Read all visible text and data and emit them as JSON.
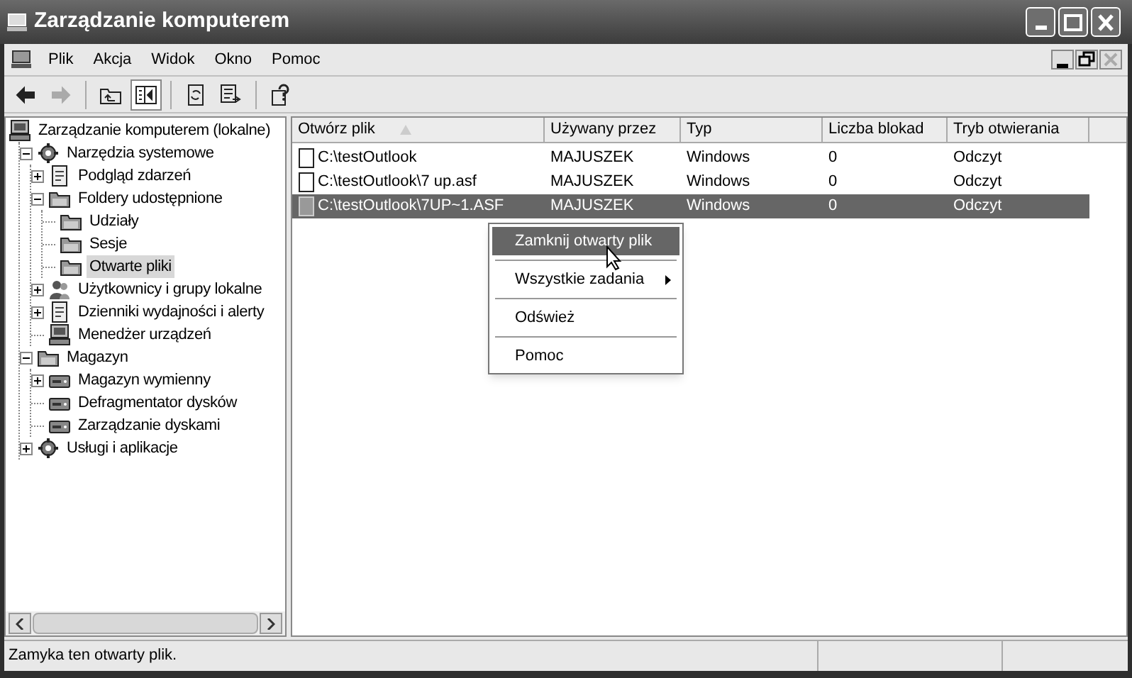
{
  "window": {
    "title": "Zarządzanie komputerem"
  },
  "menu_bar": [
    "Plik",
    "Akcja",
    "Widok",
    "Okno",
    "Pomoc"
  ],
  "mdi_controls": [
    {
      "kind": "minimize",
      "disabled": false
    },
    {
      "kind": "restore",
      "disabled": false
    },
    {
      "kind": "close",
      "disabled": true
    }
  ],
  "toolbar": [
    {
      "kind": "back",
      "disabled": false,
      "pressed": false
    },
    {
      "kind": "forward",
      "disabled": true,
      "pressed": false
    },
    {
      "kind": "separator"
    },
    {
      "kind": "up",
      "disabled": false,
      "pressed": false
    },
    {
      "kind": "tree",
      "disabled": false,
      "pressed": true
    },
    {
      "kind": "separator"
    },
    {
      "kind": "refresh",
      "disabled": false,
      "pressed": false
    },
    {
      "kind": "export",
      "disabled": false,
      "pressed": false
    },
    {
      "kind": "separator"
    },
    {
      "kind": "help",
      "disabled": false,
      "pressed": false
    }
  ],
  "tree": [
    {
      "label": "Zarządzanie komputerem (lokalne)",
      "kind": "computer",
      "selected": false,
      "children": [
        {
          "label": "Narzędzia systemowe",
          "kind": "gear",
          "expanded": true,
          "selected": false,
          "children": [
            {
              "label": "Podgląd zdarzeń",
              "kind": "document",
              "expanded": false,
              "selected": false
            },
            {
              "label": "Foldery udostępnione",
              "kind": "folder",
              "expanded": true,
              "selected": false,
              "children": [
                {
                  "label": "Udziały",
                  "kind": "folder",
                  "selected": false
                },
                {
                  "label": "Sesje",
                  "kind": "folder",
                  "selected": false
                },
                {
                  "label": "Otwarte pliki",
                  "kind": "folder",
                  "selected": true
                }
              ]
            },
            {
              "label": "Użytkownicy i grupy lokalne",
              "kind": "people",
              "expanded": false,
              "selected": false
            },
            {
              "label": "Dzienniki wydajności i alerty",
              "kind": "document",
              "expanded": false,
              "selected": false
            },
            {
              "label": "Menedżer urządzeń",
              "kind": "computer",
              "selected": false
            }
          ]
        },
        {
          "label": "Magazyn",
          "kind": "folder",
          "expanded": true,
          "selected": false,
          "children": [
            {
              "label": "Magazyn wymienny",
              "kind": "disk",
              "expanded": false,
              "selected": false
            },
            {
              "label": "Defragmentator dysków",
              "kind": "disk",
              "selected": false
            },
            {
              "label": "Zarządzanie dyskami",
              "kind": "disk",
              "selected": false
            }
          ]
        },
        {
          "label": "Usługi i aplikacje",
          "kind": "gear",
          "expanded": false,
          "selected": false
        }
      ]
    }
  ],
  "table": {
    "columns": [
      {
        "label": "Otwórz plik",
        "sorted": true
      },
      {
        "label": "Używany przez",
        "sorted": false
      },
      {
        "label": "Typ",
        "sorted": false
      },
      {
        "label": "Liczba blokad",
        "sorted": false
      },
      {
        "label": "Tryb otwierania",
        "sorted": false
      }
    ],
    "rows": [
      {
        "selected": false,
        "cells": [
          "C:\\testOutlook",
          "MAJUSZEK",
          "Windows",
          "0",
          "Odczyt"
        ]
      },
      {
        "selected": false,
        "cells": [
          "C:\\testOutlook\\7 up.asf",
          "MAJUSZEK",
          "Windows",
          "0",
          "Odczyt"
        ]
      },
      {
        "selected": true,
        "cells": [
          "C:\\testOutlook\\7UP~1.ASF",
          "MAJUSZEK",
          "Windows",
          "0",
          "Odczyt"
        ]
      }
    ]
  },
  "context_menu": [
    {
      "kind": "item",
      "label": "Zamknij otwarty plik",
      "selected": true,
      "submenu": false
    },
    {
      "kind": "separator"
    },
    {
      "kind": "item",
      "label": "Wszystkie zadania",
      "selected": false,
      "submenu": true
    },
    {
      "kind": "separator"
    },
    {
      "kind": "item",
      "label": "Odśwież",
      "selected": false,
      "submenu": false
    },
    {
      "kind": "separator"
    },
    {
      "kind": "item",
      "label": "Pomoc",
      "selected": false,
      "submenu": false
    }
  ],
  "status_bar": {
    "text": "Zamyka ten otwarty plik."
  }
}
